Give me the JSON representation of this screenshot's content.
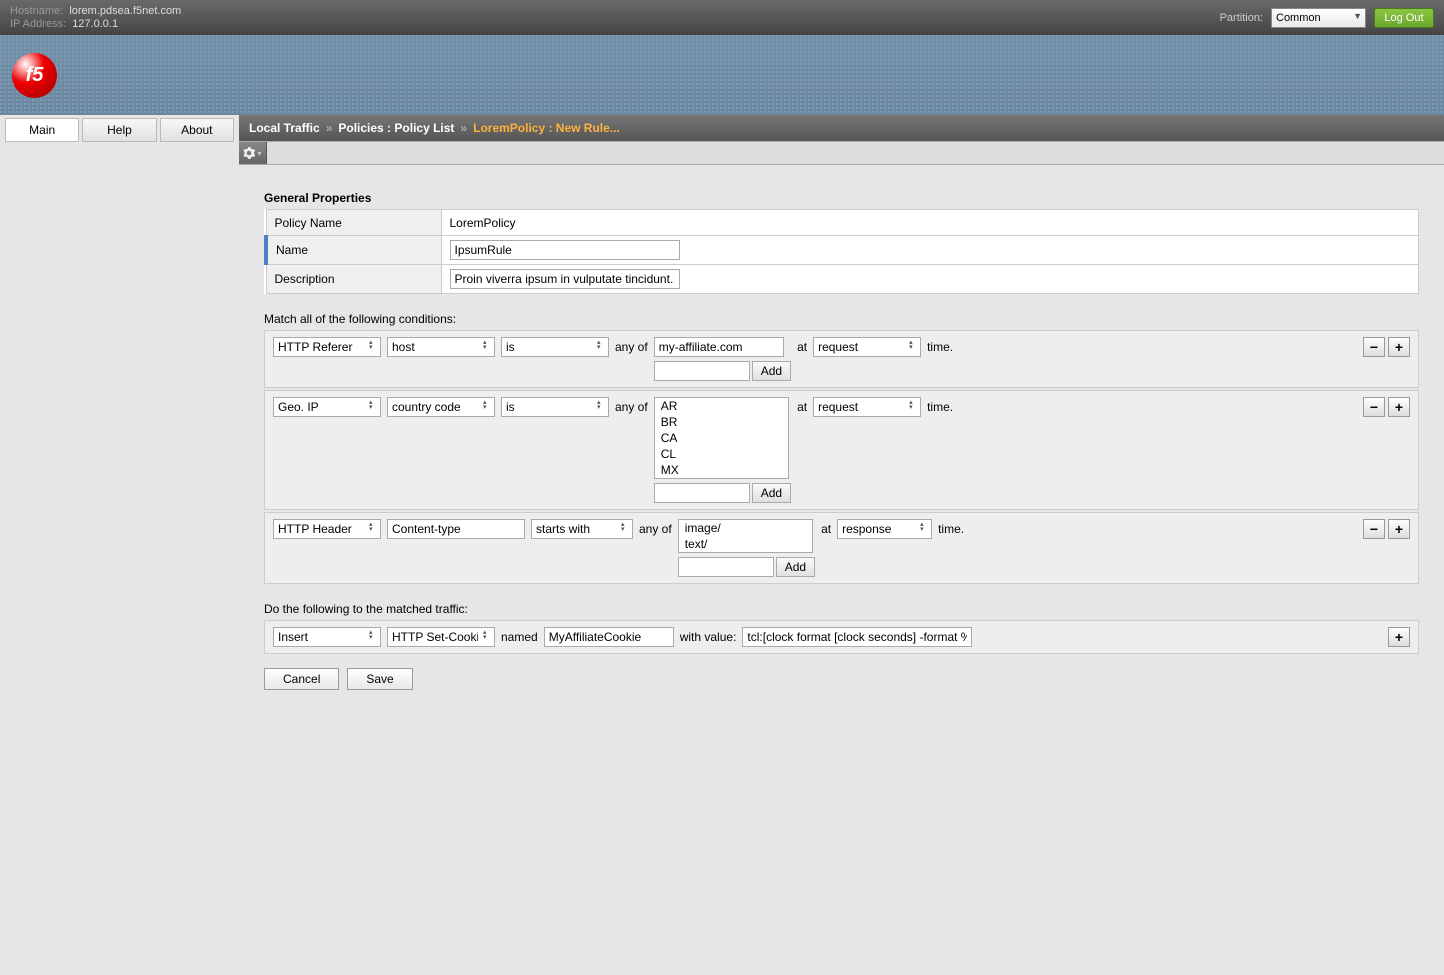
{
  "topbar": {
    "hostname_label": "Hostname:",
    "hostname": "lorem.pdsea.f5net.com",
    "ip_label": "IP Address:",
    "ip": "127.0.0.1",
    "partition_label": "Partition:",
    "partition_value": "Common",
    "logout": "Log Out"
  },
  "sidetabs": {
    "main": "Main",
    "help": "Help",
    "about": "About"
  },
  "breadcrumb": {
    "a": "Local Traffic",
    "b": "Policies : Policy List",
    "c": "LoremPolicy : New Rule..."
  },
  "section": {
    "general": "General Properties",
    "policy_name_label": "Policy Name",
    "policy_name": "LoremPolicy",
    "name_label": "Name",
    "name_value": "IpsumRule",
    "desc_label": "Description",
    "desc_value": "Proin viverra ipsum in vulputate tincidunt."
  },
  "conditions_title": "Match all of the following conditions:",
  "cond1": {
    "operand": "HTTP Referer",
    "attr": "host",
    "cmp": "is",
    "anyof": "any of",
    "val0": "my-affiliate.com",
    "at": "at",
    "phase": "request",
    "time": "time.",
    "add": "Add"
  },
  "cond2": {
    "operand": "Geo. IP",
    "attr": "country code",
    "cmp": "is",
    "anyof": "any of",
    "v0": "AR",
    "v1": "BR",
    "v2": "CA",
    "v3": "CL",
    "v4": "MX",
    "at": "at",
    "phase": "request",
    "time": "time.",
    "add": "Add"
  },
  "cond3": {
    "operand": "HTTP Header",
    "attr_value": "Content-type",
    "cmp": "starts with",
    "anyof": "any of",
    "v0": "image/",
    "v1": "text/",
    "at": "at",
    "phase": "response",
    "time": "time.",
    "add": "Add"
  },
  "actions_title": "Do the following to the matched traffic:",
  "act1": {
    "verb": "Insert",
    "target": "HTTP Set-Cookie",
    "named": "named",
    "name_value": "MyAffiliateCookie",
    "withvalue": "with value:",
    "value": "tcl:[clock format [clock seconds] -format %H"
  },
  "buttons": {
    "cancel": "Cancel",
    "save": "Save"
  }
}
